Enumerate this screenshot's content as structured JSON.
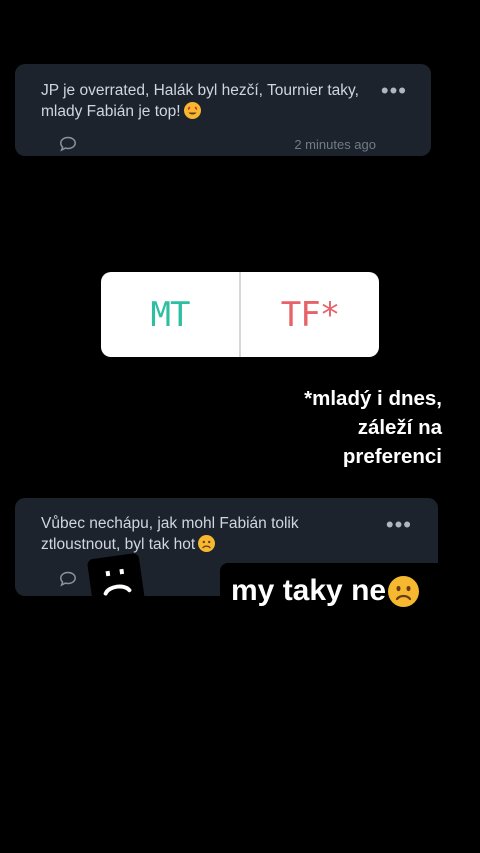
{
  "comments": [
    {
      "text": "JP je overrated, Halák byl hezčí, Tournier taky, mlady Fabián je top!",
      "emoji": "heart-eyes-emoji",
      "timestamp": "2 minutes ago",
      "menu_label": "•••"
    },
    {
      "text": "Vůbec nechápu, jak mohl Fabián tolik ztloustnout, byl tak hot",
      "emoji": "frowning-face-emoji",
      "menu_label": "•••"
    }
  ],
  "poll": {
    "option_left": "MT",
    "option_right": "TF*",
    "colors": {
      "left": "#2ebfa3",
      "right": "#e6636a"
    }
  },
  "note": {
    "line1": "*mladý i dnes,",
    "line2": "záleží na",
    "line3": "preferenci"
  },
  "sticker": {
    "icon": "sad-face-sticker-icon"
  },
  "reply": {
    "text": "my taky ne",
    "emoji": "frowning-face-emoji"
  },
  "colors": {
    "background": "#000000",
    "card": "#1c232d"
  }
}
